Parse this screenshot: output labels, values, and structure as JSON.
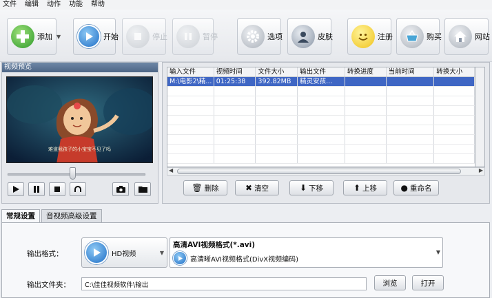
{
  "menu": [
    "文件",
    "编辑",
    "动作",
    "功能",
    "帮助"
  ],
  "toolbar": {
    "add": "添加",
    "start": "开始",
    "stop": "停止",
    "pause": "暂停",
    "options": "选项",
    "skin": "皮肤",
    "register": "注册",
    "buy": "购买",
    "website": "网站"
  },
  "preview": {
    "title": "视频预览",
    "subtitle": "难道我孩子的小宝宝不见了吗"
  },
  "table": {
    "headers": [
      "输入文件",
      "视频时间",
      "文件大小",
      "输出文件",
      "转换进度",
      "当前时间",
      "转换大小"
    ],
    "rows": [
      [
        "M:\\电影2\\精...",
        "01:25:38",
        "392.82MB",
        "精灵安孩...",
        "",
        "",
        ""
      ]
    ]
  },
  "actions": {
    "delete": "删除",
    "clear": "清空",
    "down": "下移",
    "up": "上移",
    "rename": "重命名"
  },
  "tabs": [
    "常规设置",
    "音视频高级设置"
  ],
  "settings": {
    "format_label": "输出格式：",
    "hd_button": "HD视频",
    "format_title": "高清AVI视频格式(*.avi)",
    "format_value": "高清晰AVI视频格式(DivX视频编码)",
    "folder_label": "输出文件夹：",
    "folder_value": "C:\\佳佳视频软件\\输出",
    "browse": "浏览",
    "open": "打开"
  },
  "colors": {
    "selection": "#3f66c4",
    "panel_title": "#4e6686"
  }
}
